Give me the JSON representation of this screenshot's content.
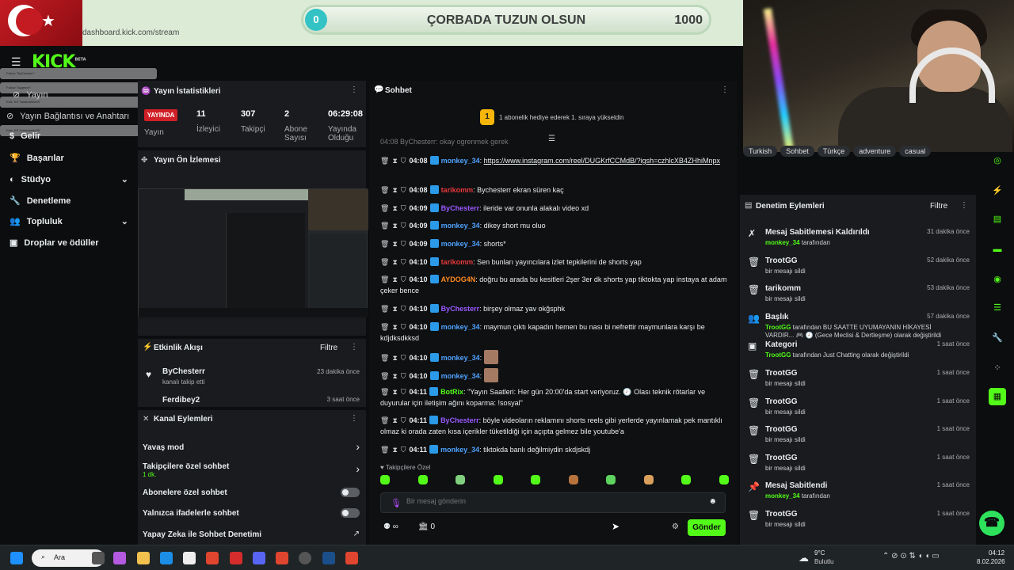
{
  "goal": {
    "start": "0",
    "title": "ÇORBADA TUZUN OLSUN",
    "end": "1000",
    "progress": 0
  },
  "browser": {
    "url": "dashboard.kick.com/stream"
  },
  "logo": {
    "text": "KICK",
    "beta": "BETA"
  },
  "toasts": [
    "Follow \"ByChesterr\"",
    "Follow \"Aygenex\"",
    "Kick: KS \"karamanlia78\"",
    "Kick: KS \"karamanlia78\""
  ],
  "nav": [
    {
      "label": "Yayın",
      "overlay": true
    },
    {
      "label": "Yayın Bağlantısı ve Anahtarı",
      "overlay": true
    },
    {
      "label": "Gelir"
    },
    {
      "label": "Başarılar"
    },
    {
      "label": "Stüdyo",
      "chevron": true
    },
    {
      "label": "Denetleme"
    },
    {
      "label": "Topluluk",
      "chevron": true
    },
    {
      "label": "Droplar ve ödüller"
    }
  ],
  "stats": {
    "title": "Yayın İstatistikleri",
    "live": "YAYINDA",
    "live_label": "Yayın",
    "cells": [
      {
        "value": "11",
        "label": "İzleyici"
      },
      {
        "value": "307",
        "label": "Takipçi"
      },
      {
        "value": "2",
        "label": "Abone Sayısı"
      },
      {
        "value": "06:29:08",
        "label": "Yayında Olduğu"
      }
    ]
  },
  "preview": {
    "title": "Yayın Ön İzlemesi"
  },
  "activity": {
    "title": "Etkinlik Akışı",
    "filter": "Filtre",
    "items": [
      {
        "user": "ByChesterr",
        "desc": "kanalı takip etti",
        "time": "23 dakika önce"
      },
      {
        "user": "Ferdibey2",
        "desc": "",
        "time": "3 saat önce"
      }
    ]
  },
  "actions": {
    "title": "Kanal Eylemleri",
    "items": [
      {
        "label": "Yavaş mod",
        "kind": "arrow"
      },
      {
        "label": "Takipçilere özel sohbet",
        "sub": "1 dk.",
        "kind": "arrow"
      },
      {
        "label": "Abonelere özel sohbet",
        "kind": "toggle"
      },
      {
        "label": "Yalnızca ifadelerle sohbet",
        "kind": "toggle"
      },
      {
        "label": "Yapay Zeka ile Sohbet Denetimi",
        "kind": "external"
      }
    ]
  },
  "chat": {
    "title": "Sohbet",
    "pin_text": "1 abonelik hediye ederek 1. sıraya yükseldin",
    "pin_rank": "1",
    "partial_top": "04:08 ByChesterr: okay ogrenmek gerek",
    "messages": [
      {
        "time": "04:08",
        "user": "monkey_34",
        "color": "#4fa3ff",
        "text": "https://www.instagram.com/reel/DUGKrfCCMdB/?igsh=czhlcXB4ZHhiMnpx",
        "link": true
      },
      {
        "time": "04:08",
        "user": "tarikomm",
        "color": "#e8383d",
        "text": "Bychesterr ekran süren kaç"
      },
      {
        "time": "04:09",
        "user": "ByChesterr",
        "color": "#9b59ff",
        "text": "ileride var onunla alakalı video xd"
      },
      {
        "time": "04:09",
        "user": "monkey_34",
        "color": "#4fa3ff",
        "text": "dikey short mu oluo"
      },
      {
        "time": "04:09",
        "user": "monkey_34",
        "color": "#4fa3ff",
        "text": "shorts*"
      },
      {
        "time": "04:10",
        "user": "tarikomm",
        "color": "#e8383d",
        "text": "Sen bunları yayıncılara izlet tepkilerini de shorts yap"
      },
      {
        "time": "04:10",
        "user": "AYDOG4N",
        "color": "#ff8a1e",
        "text": "doğru bu arada bu kesitleri 2şer 3er dk shorts yap tiktokta yap instaya at adam çeker bence"
      },
      {
        "time": "04:10",
        "user": "ByChesterr",
        "color": "#9b59ff",
        "text": "birşey olmaz yav okğsphk"
      },
      {
        "time": "04:10",
        "user": "monkey_34",
        "color": "#4fa3ff",
        "text": "maymun çıktı kapadın hemen bu nası bi nefrettir maymunlara karşı be kdjdksdkksd"
      },
      {
        "time": "04:10",
        "user": "monkey_34",
        "color": "#4fa3ff",
        "text": ""
      },
      {
        "time": "04:10",
        "user": "monkey_34",
        "color": "#4fa3ff",
        "text": ""
      },
      {
        "time": "04:11",
        "user": "BotRix",
        "color": "#53fc18",
        "text": "\"Yayın Saatleri: Her gün 20:00'da start veriyoruz. 🕗 Olası teknik rötarlar ve duyurular için iletişim ağını koparma: !sosyal\""
      },
      {
        "time": "04:11",
        "user": "ByChesterr",
        "color": "#9b59ff",
        "text": "böyle videoların reklamını shorts reels gibi yerlerde yayınlamak pek mantıklı olmaz ki orada zaten kısa içerikler tüketildiği için açıpta gelmez bile youtube'a"
      },
      {
        "time": "04:11",
        "user": "monkey_34",
        "color": "#4fa3ff",
        "text": "tiktokda banlı değilmiydin skdjskdj"
      }
    ],
    "followers_only": "Takipçilere Özel",
    "placeholder": "Bir mesaj gönderin",
    "loop_count": "∞",
    "pack_count": "0",
    "send": "Gönder"
  },
  "tags": [
    "Turkish",
    "Sohbet",
    "Türkçe",
    "adventure",
    "casual"
  ],
  "modlog": {
    "title": "Denetim Eylemleri",
    "filter": "Filtre",
    "items": [
      {
        "icon": "unpin-icon",
        "title": "Mesaj Sabitlemesi Kaldırıldı",
        "actor": "monkey_34",
        "rest": " tarafından",
        "time": "31 dakika önce"
      },
      {
        "icon": "trash-icon",
        "title": "TrootGG",
        "actor": "",
        "rest": "bir mesajı sildi",
        "time": "52 dakika önce"
      },
      {
        "icon": "trash-icon",
        "title": "tarikomm",
        "actor": "",
        "rest": "bir mesajı sildi",
        "time": "53 dakika önce"
      },
      {
        "icon": "users-icon",
        "title": "Başlık",
        "actor": "TrootGG",
        "rest": " tarafından BU SAATTE UYUMAYANIN HİKAYESİ VARDIR... 🎮 🕗 (Gece Meclisi & Dertleşme) olarak değiştirildi",
        "time": "57 dakika önce"
      },
      {
        "icon": "category-icon",
        "title": "Kategori",
        "actor": "TrootGG",
        "rest": " tarafından Just Chatting olarak değiştirildi",
        "time": "1 saat önce"
      },
      {
        "icon": "trash-icon",
        "title": "TrootGG",
        "actor": "",
        "rest": "bir mesajı sildi",
        "time": "1 saat önce"
      },
      {
        "icon": "trash-icon",
        "title": "TrootGG",
        "actor": "",
        "rest": "bir mesajı sildi",
        "time": "1 saat önce"
      },
      {
        "icon": "trash-icon",
        "title": "TrootGG",
        "actor": "",
        "rest": "bir mesajı sildi",
        "time": "1 saat önce"
      },
      {
        "icon": "trash-icon",
        "title": "TrootGG",
        "actor": "",
        "rest": "bir mesajı sildi",
        "time": "1 saat önce"
      },
      {
        "icon": "pin-icon",
        "title": "Mesaj Sabitlendi",
        "actor": "monkey_34",
        "rest": " tarafından",
        "time": "1 saat önce"
      },
      {
        "icon": "trash-icon",
        "title": "TrootGG",
        "actor": "",
        "rest": "bir mesajı sildi",
        "time": "1 saat önce"
      }
    ]
  },
  "taskbar": {
    "search": "Ara",
    "weather_temp": "9°C",
    "weather_desc": "Bulutlu",
    "time": "04:12",
    "date": "8.02.2026"
  },
  "colors": {
    "kick_green": "#53fc18",
    "panel": "#191b1f",
    "bg": "#0b0d0e",
    "live_red": "#d11f27"
  }
}
